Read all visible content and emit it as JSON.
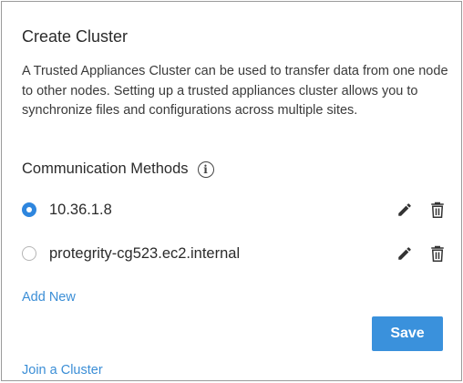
{
  "dialog": {
    "title": "Create Cluster",
    "description": "A Trusted Appliances Cluster can be used to transfer data from one node to other nodes. Setting up a trusted appliances cluster allows you to synchronize files and configurations across multiple sites."
  },
  "communication": {
    "heading": "Communication Methods",
    "info_icon": "info-icon",
    "methods": [
      {
        "label": "10.36.1.8",
        "selected": true
      },
      {
        "label": "protegrity-cg523.ec2.internal",
        "selected": false
      }
    ],
    "edit_icon": "pencil-icon",
    "delete_icon": "trash-icon"
  },
  "links": {
    "add_new": "Add New",
    "join_cluster": "Join a Cluster"
  },
  "buttons": {
    "save": "Save"
  },
  "colors": {
    "accent": "#3a91dc",
    "link": "#3b8ed6",
    "text": "#2b2b2b"
  }
}
